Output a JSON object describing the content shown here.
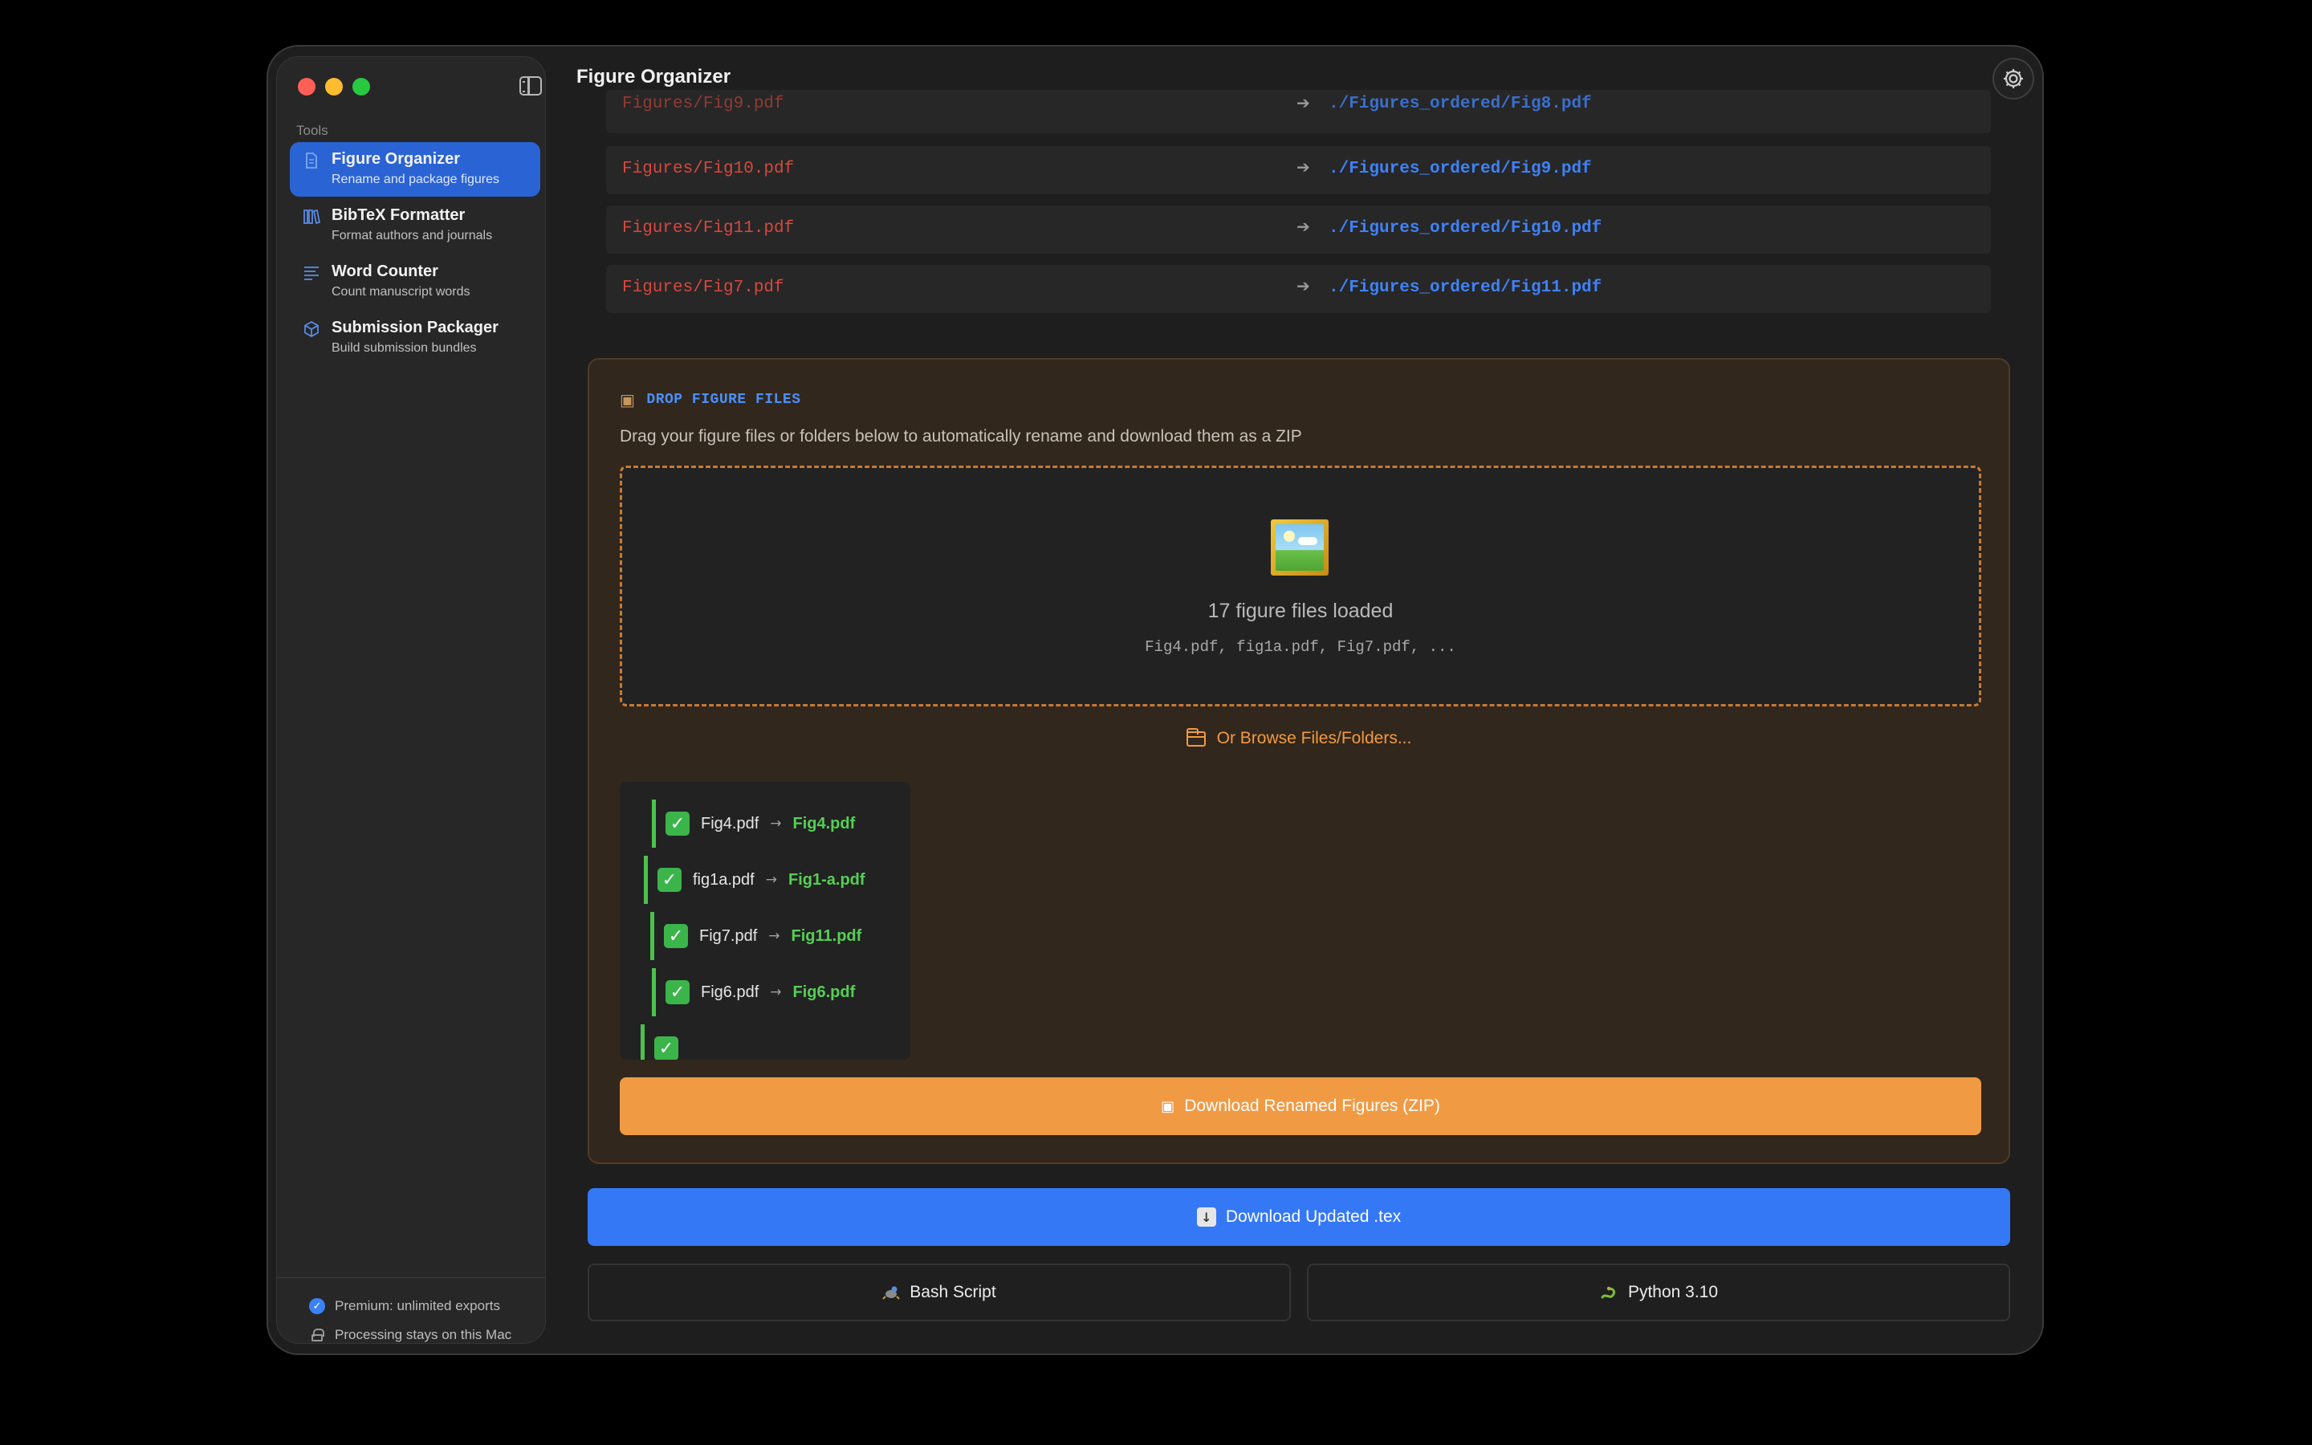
{
  "window": {
    "title": "Figure Organizer"
  },
  "sidebar": {
    "section_label": "Tools",
    "items": [
      {
        "title": "Figure Organizer",
        "subtitle": "Rename and package figures",
        "icon": "document-icon",
        "active": true
      },
      {
        "title": "BibTeX Formatter",
        "subtitle": "Format authors and journals",
        "icon": "books-icon",
        "active": false
      },
      {
        "title": "Word Counter",
        "subtitle": "Count manuscript words",
        "icon": "text-lines-icon",
        "active": false
      },
      {
        "title": "Submission Packager",
        "subtitle": "Build submission bundles",
        "icon": "cube-icon",
        "active": false
      }
    ],
    "footer": {
      "premium": "Premium: unlimited exports",
      "privacy": "Processing stays on this Mac"
    }
  },
  "mappings": [
    {
      "from": "Figures/Fig9.pdf",
      "arrow": "➔",
      "to": "./Figures_ordered/Fig8.pdf"
    },
    {
      "from": "Figures/Fig10.pdf",
      "arrow": "➔",
      "to": "./Figures_ordered/Fig9.pdf"
    },
    {
      "from": "Figures/Fig11.pdf",
      "arrow": "➔",
      "to": "./Figures_ordered/Fig10.pdf"
    },
    {
      "from": "Figures/Fig7.pdf",
      "arrow": "➔",
      "to": "./Figures_ordered/Fig11.pdf"
    }
  ],
  "drop": {
    "heading": "DROP FIGURE FILES",
    "description": "Drag your figure files or folders below to automatically rename and download them as a ZIP",
    "loaded_text": "17 figure files loaded",
    "loaded_files": "Fig4.pdf, fig1a.pdf, Fig7.pdf, ...",
    "browse_label": "Or Browse Files/Folders...",
    "results": [
      {
        "from": "Fig4.pdf",
        "arrow": "→",
        "to": "Fig4.pdf"
      },
      {
        "from": "fig1a.pdf",
        "arrow": "→",
        "to": "Fig1-a.pdf"
      },
      {
        "from": "Fig7.pdf",
        "arrow": "→",
        "to": "Fig11.pdf"
      },
      {
        "from": "Fig6.pdf",
        "arrow": "→",
        "to": "Fig6.pdf"
      }
    ],
    "zip_button": "Download Renamed Figures (ZIP)"
  },
  "actions": {
    "tex_button": "Download Updated .tex",
    "bash_button": "Bash Script",
    "python_button": "Python 3.10"
  },
  "colors": {
    "accent_blue": "#3478f6",
    "accent_orange": "#f19a44",
    "source_red": "#d8473f",
    "success_green": "#55cf55"
  }
}
